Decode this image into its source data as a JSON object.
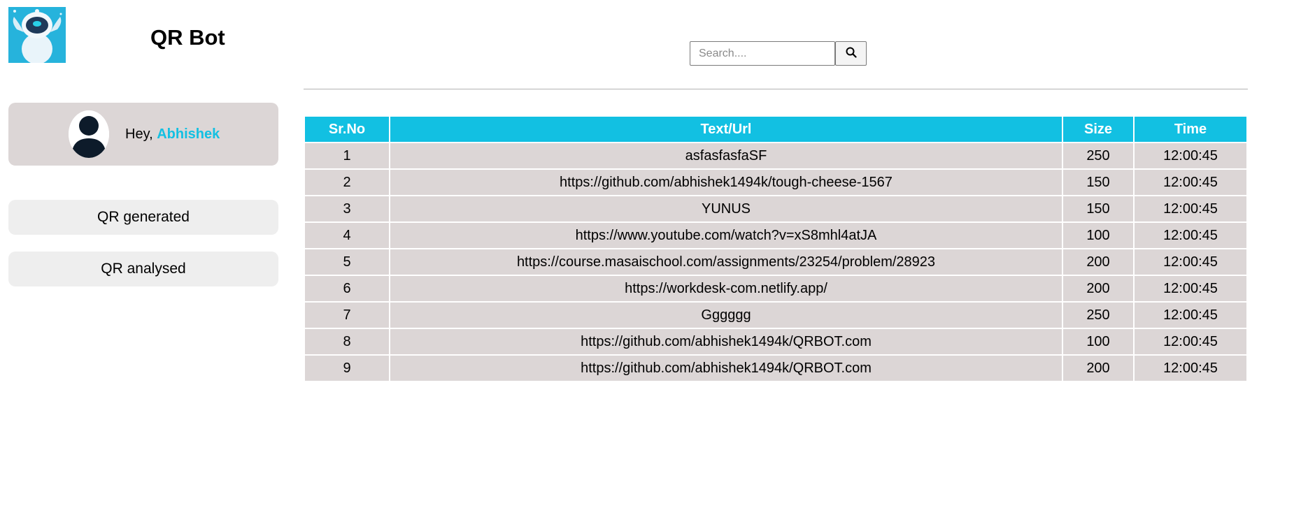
{
  "app": {
    "title": "QR Bot"
  },
  "profile": {
    "greeting": "Hey,",
    "name": "Abhishek"
  },
  "sidebar": {
    "items": [
      {
        "label": "QR generated"
      },
      {
        "label": "QR analysed"
      }
    ]
  },
  "search": {
    "placeholder": "Search....",
    "value": "",
    "icon": "search-icon"
  },
  "colors": {
    "accent": "#12c0e2",
    "row_bg": "#dcd6d6",
    "button_bg": "#eeeeee"
  },
  "table": {
    "headers": [
      "Sr.No",
      "Text/Url",
      "Size",
      "Time"
    ],
    "rows": [
      [
        "1",
        "asfasfasfaSF",
        "250",
        "12:00:45"
      ],
      [
        "2",
        "https://github.com/abhishek1494k/tough-cheese-1567",
        "150",
        "12:00:45"
      ],
      [
        "3",
        "YUNUS",
        "150",
        "12:00:45"
      ],
      [
        "4",
        "https://www.youtube.com/watch?v=xS8mhl4atJA",
        "100",
        "12:00:45"
      ],
      [
        "5",
        "https://course.masaischool.com/assignments/23254/problem/28923",
        "200",
        "12:00:45"
      ],
      [
        "6",
        "https://workdesk-com.netlify.app/",
        "200",
        "12:00:45"
      ],
      [
        "7",
        "Gggggg",
        "250",
        "12:00:45"
      ],
      [
        "8",
        "https://github.com/abhishek1494k/QRBOT.com",
        "100",
        "12:00:45"
      ],
      [
        "9",
        "https://github.com/abhishek1494k/QRBOT.com",
        "200",
        "12:00:45"
      ]
    ]
  }
}
